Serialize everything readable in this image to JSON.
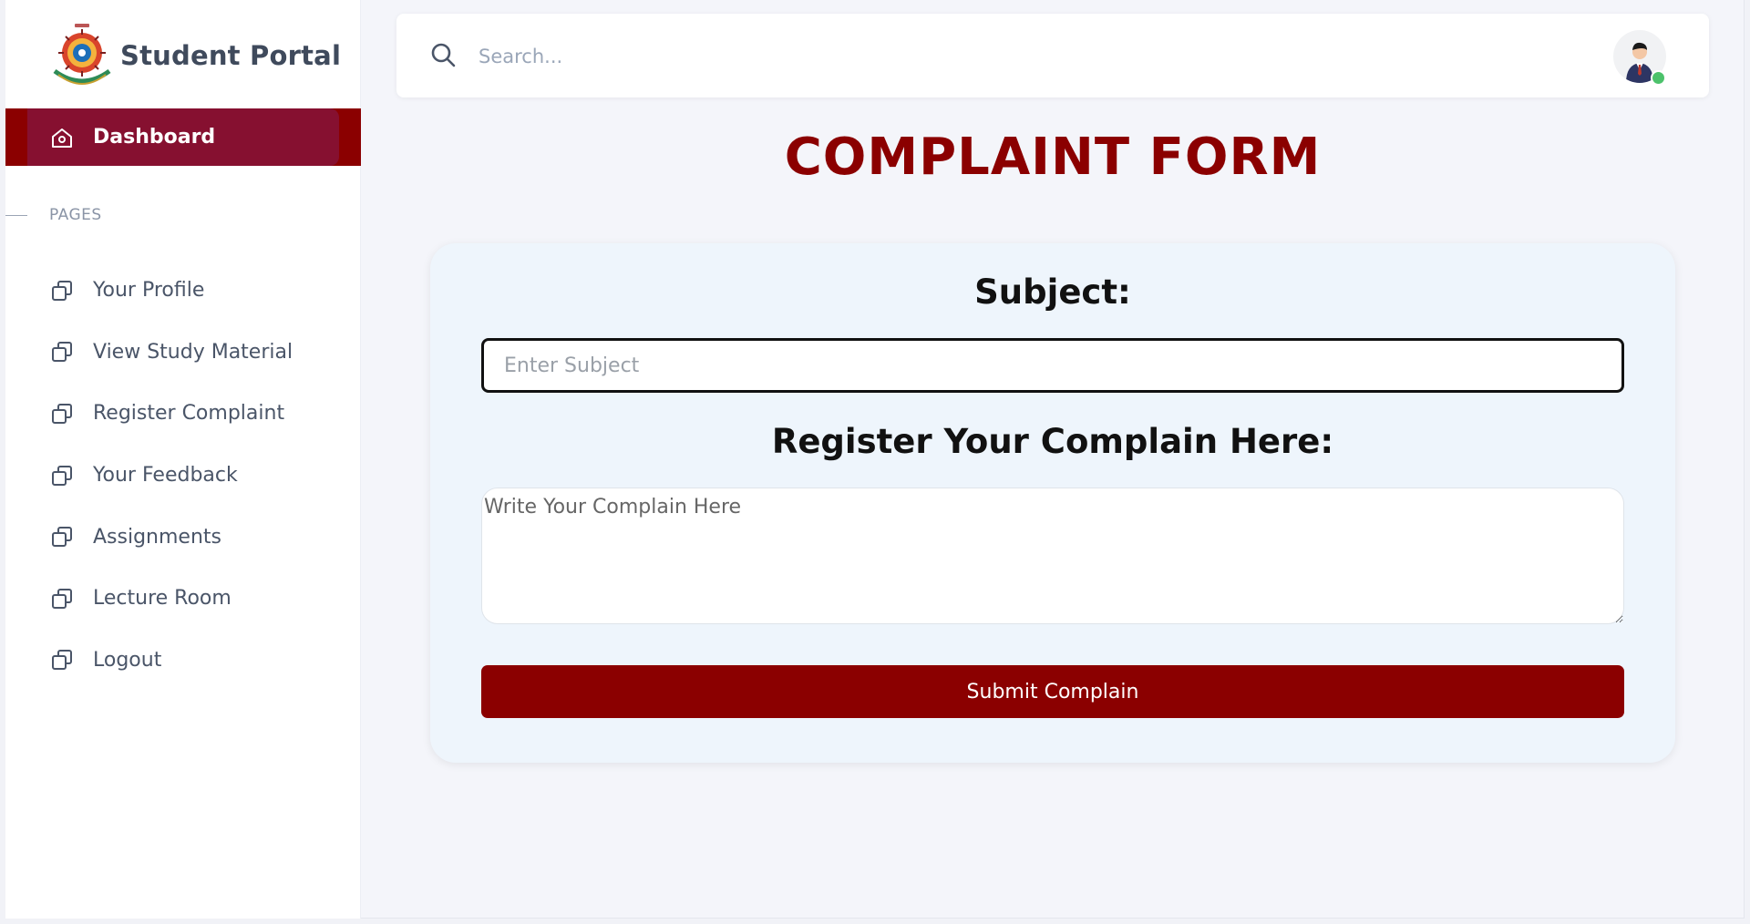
{
  "brand": {
    "name": "Student Portal",
    "logo_icon": "university-emblem-icon"
  },
  "sidebar": {
    "active_item": {
      "label": "Dashboard",
      "icon": "home-icon"
    },
    "section_caption": "PAGES",
    "items": [
      {
        "label": "Your Profile",
        "icon": "copy-icon"
      },
      {
        "label": "View Study Material",
        "icon": "copy-icon"
      },
      {
        "label": "Register Complaint",
        "icon": "copy-icon"
      },
      {
        "label": "Your Feedback",
        "icon": "copy-icon"
      },
      {
        "label": "Assignments",
        "icon": "copy-icon"
      },
      {
        "label": "Lecture Room",
        "icon": "copy-icon"
      },
      {
        "label": "Logout",
        "icon": "copy-icon"
      }
    ]
  },
  "topbar": {
    "search_placeholder": "Search...",
    "avatar_icon": "user-avatar-icon",
    "status": "online"
  },
  "page": {
    "title": "COMPLAINT FORM"
  },
  "form": {
    "subject_label": "Subject:",
    "subject_placeholder": "Enter Subject",
    "subject_value": "",
    "complain_label": "Register Your Complain Here:",
    "complain_placeholder": "Write Your Complain Here",
    "complain_value": "",
    "submit_label": "Submit Complain"
  },
  "colors": {
    "accent": "#8b0000",
    "active_nav": "#861030",
    "card_bg": "#eef5fc",
    "online": "#4cc26b"
  }
}
